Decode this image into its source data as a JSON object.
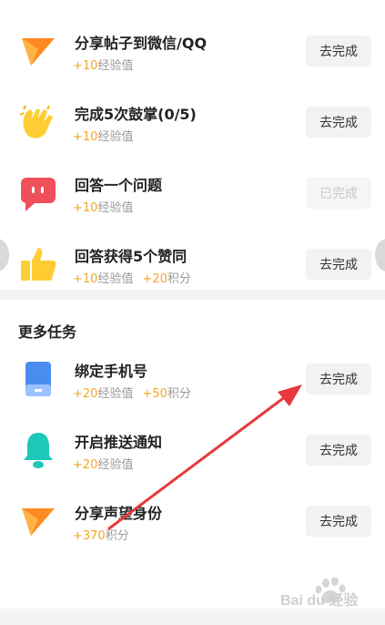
{
  "tasks": [
    {
      "title": "分享帖子到微信/QQ",
      "rewards": [
        {
          "value": "+10",
          "label": "经验值"
        }
      ],
      "button": "去完成",
      "icon": "paper-plane-icon"
    },
    {
      "title": "完成5次鼓掌(0/5)",
      "rewards": [
        {
          "value": "+10",
          "label": "经验值"
        }
      ],
      "button": "去完成",
      "icon": "clapping-hands-icon"
    },
    {
      "title": "回答一个问题",
      "rewards": [
        {
          "value": "+10",
          "label": "经验值"
        }
      ],
      "button": "已完成",
      "icon": "chat-bubble-icon"
    },
    {
      "title": "回答获得5个赞同",
      "rewards": [
        {
          "value": "+10",
          "label": "经验值"
        },
        {
          "value": "+20",
          "label": "积分"
        }
      ],
      "button": "去完成",
      "icon": "thumbs-up-icon"
    }
  ],
  "more_section": {
    "title": "更多任务"
  },
  "more_tasks": [
    {
      "title": "绑定手机号",
      "rewards": [
        {
          "value": "+20",
          "label": "经验值"
        },
        {
          "value": "+50",
          "label": "积分"
        }
      ],
      "button": "去完成",
      "icon": "phone-icon"
    },
    {
      "title": "开启推送通知",
      "rewards": [
        {
          "value": "+20",
          "label": "经验值"
        }
      ],
      "button": "去完成",
      "icon": "bell-icon"
    },
    {
      "title": "分享声望身份",
      "rewards": [
        {
          "value": "+370",
          "label": "积分"
        }
      ],
      "button": "去完成",
      "icon": "paper-plane-icon"
    }
  ],
  "watermark": {
    "text": "Bai du 经验"
  },
  "colors": {
    "accent": "#f5a623",
    "arrow": "#e8383d",
    "icon_orange": "#ff8a1f",
    "icon_red": "#f0505a",
    "icon_teal": "#1dc8b8",
    "icon_blue": "#4a8cf0"
  }
}
